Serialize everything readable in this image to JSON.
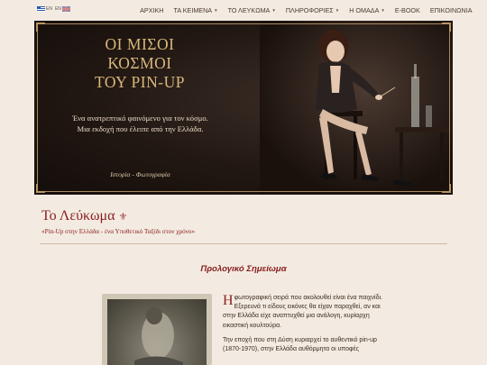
{
  "nav": {
    "lang_gr": "EN",
    "lang_en": "EN",
    "items": [
      {
        "label": "ΑΡΧΙΚΗ",
        "has_caret": false
      },
      {
        "label": "ΤΑ ΚΕΙΜΕΝΑ",
        "has_caret": true
      },
      {
        "label": "ΤΟ ΛΕΥΚΩΜΑ",
        "has_caret": true
      },
      {
        "label": "ΠΛΗΡΟΦΟΡΙΕΣ",
        "has_caret": true
      },
      {
        "label": "Η ΟΜΑΔΑ",
        "has_caret": true
      },
      {
        "label": "E-BOOK",
        "has_caret": false
      },
      {
        "label": "ΕΠΙΚΟΙΝΩΝΙΑ",
        "has_caret": false
      }
    ]
  },
  "hero": {
    "title_line1": "ΟΙ ΜΙΣΟΙ",
    "title_line2": "ΚΟΣΜΟΙ",
    "title_line3": "ΤΟΥ PIN-UP",
    "subtitle_line1": "Ένα ανατρεπτικό φαινόμενο για τον κόσμο.",
    "subtitle_line2": "Μια εκδοχή που έλειπε από την Ελλάδα.",
    "tagline": "Ιστορία - Φωτογραφία"
  },
  "section": {
    "title": "Το Λεύκωμα",
    "subtitle": "«Pin-Up στην Ελλάδα - ένα Υποθετικό Ταξίδι στον χρόνο»",
    "prologue_heading": "Προλογικό Σημείωμα"
  },
  "body": {
    "dropcap": "Η",
    "para1": " φωτογραφική σειρά που ακολουθεί είναι ένα παιχνίδι. Εξερευνά τι είδους εικόνες θα είχαν παραχθεί, αν και στην Ελλάδα είχε αναπτυχθεί μια ανάλογη, κυρίαρχη εικαστική κουλτούρα.",
    "para2": "Την εποχή που στη Δύση κυριαρχεί το αυθεντικό pin-up (1870-1970), στην Ελλάδα αυθόρμητα οι υποφές"
  },
  "colors": {
    "accent": "#8a1f20",
    "gold": "#d9b87c",
    "background": "#f3ebe1"
  }
}
